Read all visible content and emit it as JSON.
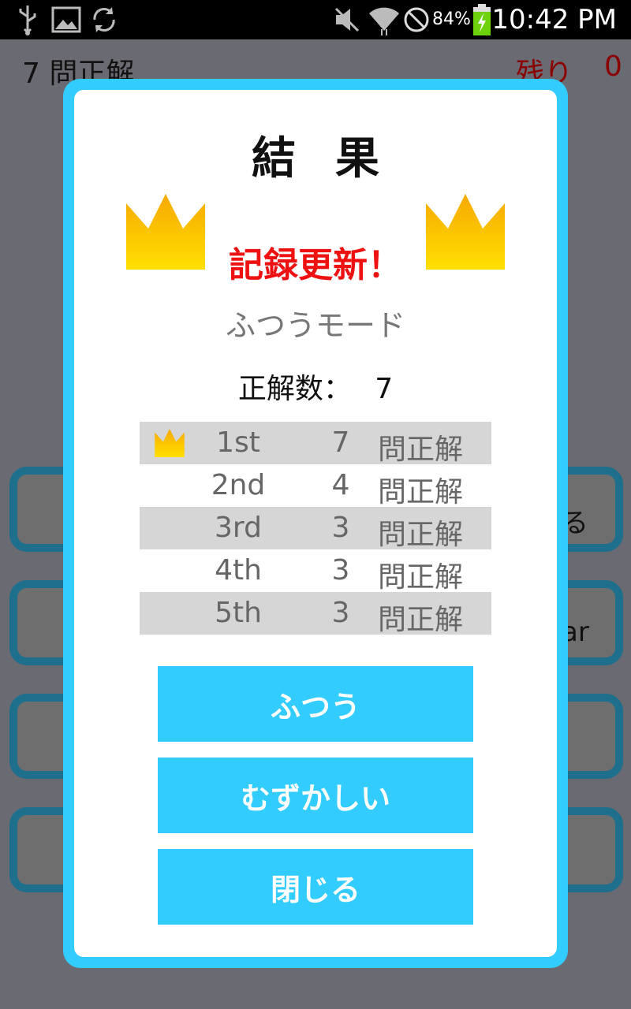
{
  "status_bar": {
    "battery_percent": "84%",
    "time": "10:42 PM",
    "icons": [
      "usb-icon",
      "image-icon",
      "sync-icon",
      "mute-icon",
      "wifi-icon",
      "no-sim-icon",
      "battery-charging-icon"
    ]
  },
  "background": {
    "score_text": "7 問正解",
    "remain_label": "残り",
    "remain_value": "0",
    "button_fragments": [
      "る",
      "ar"
    ]
  },
  "dialog": {
    "title": "結果",
    "record_text": "記録更新！",
    "mode_label": "ふつうモード",
    "correct_label": "正解数：",
    "correct_value": "7",
    "ranking": [
      {
        "place": "1st",
        "score": "7",
        "unit": "問正解",
        "crown": true
      },
      {
        "place": "2nd",
        "score": "4",
        "unit": "問正解",
        "crown": false
      },
      {
        "place": "3rd",
        "score": "3",
        "unit": "問正解",
        "crown": false
      },
      {
        "place": "4th",
        "score": "3",
        "unit": "問正解",
        "crown": false
      },
      {
        "place": "5th",
        "score": "3",
        "unit": "問正解",
        "crown": false
      }
    ],
    "buttons": {
      "normal": "ふつう",
      "hard": "むずかしい",
      "close": "閉じる"
    }
  },
  "colors": {
    "accent": "#33ccff",
    "record": "#ee1111",
    "crown": "#ffcc00"
  }
}
